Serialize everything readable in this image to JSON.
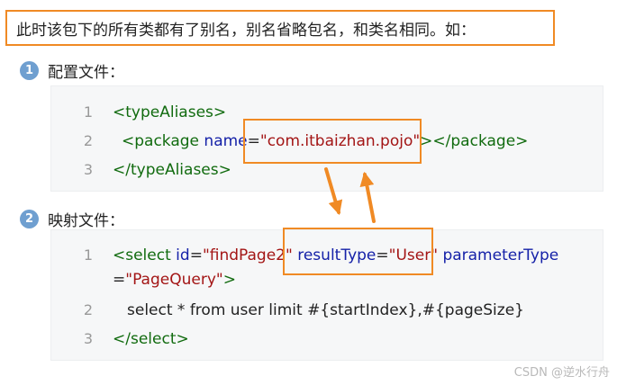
{
  "heading": "此时该包下的所有类都有了别名，别名省略包名，和类名相同。如：",
  "step1": {
    "number": "1",
    "label": "配置文件："
  },
  "step2": {
    "number": "2",
    "label": "映射文件："
  },
  "code1": {
    "line_numbers": [
      "1",
      "2",
      "3"
    ],
    "line1_tag": "<typeAliases>",
    "line2_open": "<package",
    "line2_attr": "name",
    "line2_eq": "=",
    "line2_value": "\"com.itbaizhan.pojo\"",
    "line2_close": "></package>",
    "line3_tag": "</typeAliases>"
  },
  "code2": {
    "line_numbers": [
      "1",
      "2",
      "3"
    ],
    "line1_open": "<select",
    "line1_id_attr": "id",
    "line1_eq": "=",
    "line1_id_value": "\"findPage2\"",
    "line1_rt_attr": "resultType",
    "line1_rt_value": "\"User\"",
    "line1_pt_attr": "parameterType",
    "line1b_eq": "=",
    "line1b_pt_value": "\"PageQuery\"",
    "line1b_close": ">",
    "line2_text": "select * from user limit #{startIndex},#{pageSize}",
    "line3_tag": "</select>"
  },
  "watermark": "CSDN @逆水行舟"
}
